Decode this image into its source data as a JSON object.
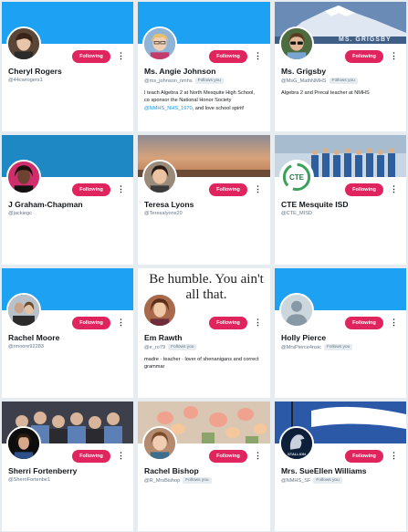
{
  "cards": [
    {
      "name": "Cheryl Rogers",
      "handle": "@44cwrogers1",
      "follows_you": "",
      "bio": "",
      "button": "Following",
      "menu": "⋮"
    },
    {
      "name": "Ms. Angie Johnson",
      "handle": "@ms_johnson_nmhs",
      "follows_you": "Follows you",
      "bio_before": "I teach Algebra 2 at North Mesquite High School, co sponsor the National Honor Society ",
      "bio_link": "@NMHS_NHS_1970",
      "bio_after": ", and love school spirit!",
      "button": "Following",
      "menu": "⋮"
    },
    {
      "name": "Ms. Grigsby",
      "handle": "@MsG_MathNMHS",
      "follows_you": "Follows you",
      "bio": "Algebra 2 and Precal teacher at NMHS",
      "button": "Following",
      "menu": "⋮",
      "banner_text": "MS. GRIGSBY"
    },
    {
      "name": "J Graham-Chapman",
      "handle": "@jackiegc",
      "follows_you": "",
      "bio": "",
      "button": "Following",
      "menu": "⋮"
    },
    {
      "name": "Teresa Lyons",
      "handle": "@Teresalyons20",
      "follows_you": "",
      "bio": "",
      "button": "Following",
      "menu": "⋮"
    },
    {
      "name": "CTE Mesquite ISD",
      "handle": "@CTE_MISD",
      "follows_you": "",
      "bio": "",
      "button": "Following",
      "menu": "⋮",
      "avatar_text": "CTE"
    },
    {
      "name": "Rachel Moore",
      "handle": "@rmoore92283",
      "follows_you": "",
      "bio": "",
      "button": "Following",
      "menu": "⋮"
    },
    {
      "name": "Em Rawth",
      "handle": "@e_ro79",
      "follows_you": "Follows you",
      "bio": "madre · teacher · lover of shenanigans and correct grammar",
      "button": "Following",
      "menu": "⋮",
      "banner_text": "Be humble. You ain't all that."
    },
    {
      "name": "Holly Pierce",
      "handle": "@MrsPierce4nsic",
      "follows_you": "Follows you",
      "bio": "",
      "button": "Following",
      "menu": "⋮"
    },
    {
      "name": "Sherri Fortenberry",
      "handle": "@SherriFortenbe1",
      "follows_you": "",
      "bio": "",
      "button": "Following",
      "menu": "⋮"
    },
    {
      "name": "Rachel Bishop",
      "handle": "@R_MrsBishop",
      "follows_you": "Follows you",
      "bio": "",
      "button": "Following",
      "menu": "⋮"
    },
    {
      "name": "Mrs. SueEllen Williams",
      "handle": "@NMHS_SF",
      "follows_you": "Follows you",
      "bio": "",
      "button": "Following",
      "menu": "⋮",
      "avatar_text": "STALLION"
    }
  ],
  "colors": {
    "following_button": "#e0245e",
    "twitter_blue": "#1da1f2",
    "link": "#1b95e0"
  }
}
